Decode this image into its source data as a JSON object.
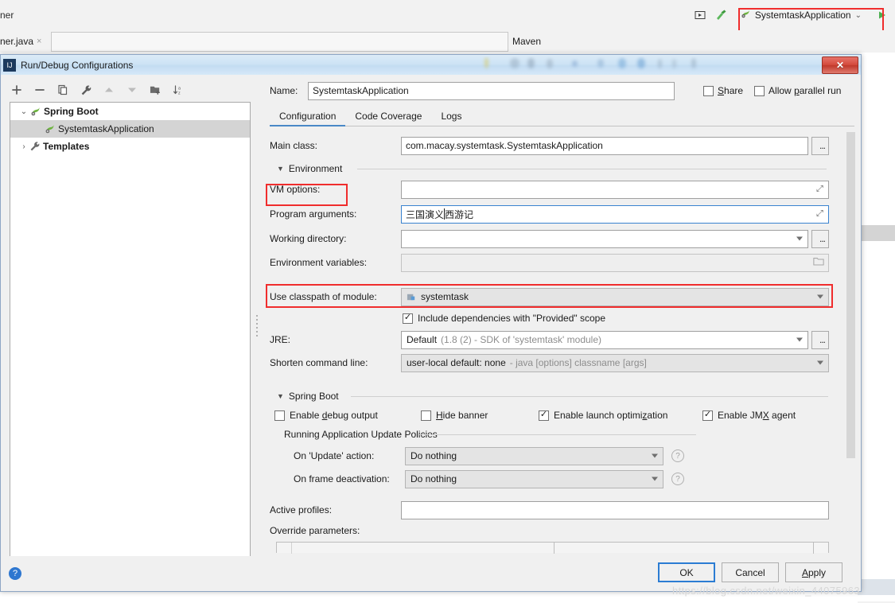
{
  "ide": {
    "topbar_label": "ner",
    "run_config_chip": "SystemtaskApplication",
    "editor_tab": "ner.java",
    "editor_tab_close": "×",
    "maven_label": "Maven"
  },
  "dialog": {
    "title": "Run/Debug Configurations",
    "close_label": "✕",
    "toolbar": {
      "add": "+",
      "remove": "−",
      "copy": "copy",
      "edit_templates": "wrench",
      "move_up": "▲",
      "move_down": "▼",
      "new_folder": "folder-add",
      "sort": "sort-alpha"
    },
    "tree": [
      {
        "label": "Spring Boot",
        "expanded": true,
        "twisty": "⌄",
        "bold": true,
        "selected": false
      },
      {
        "label": "SystemtaskApplication",
        "expanded": false,
        "twisty": "",
        "bold": false,
        "selected": true
      },
      {
        "label": "Templates",
        "expanded": false,
        "twisty": "›",
        "bold": true,
        "selected": false
      }
    ],
    "name_label": "Name:",
    "name_value": "SystemtaskApplication",
    "share_label": "Share",
    "share_mnemonic": "S",
    "share_checked": false,
    "allow_parallel_label": "Allow parallel run",
    "allow_parallel_checked": false,
    "tabs": [
      {
        "label": "Configuration",
        "active": true
      },
      {
        "label": "Code Coverage",
        "active": false
      },
      {
        "label": "Logs",
        "active": false
      }
    ],
    "fields": {
      "main_class_label": "Main class:",
      "main_class_value": "com.macay.systemtask.SystemtaskApplication",
      "environment_section": "Environment",
      "vm_options_label": "VM options:",
      "vm_options_value": "",
      "program_arguments_label": "Program arguments:",
      "program_arguments_value": "三国演义 西游记",
      "program_arguments_pre_caret": "三国演义 ",
      "program_arguments_post_caret": "西游记",
      "working_directory_label": "Working directory:",
      "working_directory_value": "",
      "environment_variables_label": "Environment variables:",
      "environment_variables_value": "",
      "classpath_label": "Use classpath of module:",
      "classpath_value": "systemtask",
      "include_provided_label": "Include dependencies with \"Provided\" scope",
      "include_provided_checked": true,
      "jre_label": "JRE:",
      "jre_value_main": "Default",
      "jre_value_detail": "(1.8 (2) - SDK of 'systemtask' module)",
      "shorten_label": "Shorten command line:",
      "shorten_value_main": "user-local default: none",
      "shorten_value_detail": "- java [options] classname [args]",
      "spring_boot_section": "Spring Boot",
      "enable_debug_label": "Enable debug output",
      "enable_debug_mnemonic": "d",
      "enable_debug_checked": false,
      "hide_banner_label": "Hide banner",
      "hide_banner_mnemonic": "H",
      "hide_banner_checked": false,
      "enable_launch_opt_label": "Enable launch optimization",
      "enable_launch_opt_checked": true,
      "enable_jmx_label": "Enable JMX agent",
      "enable_jmx_checked": true,
      "update_policies_section": "Running Application Update Policies",
      "on_update_label": "On 'Update' action:",
      "on_update_value": "Do nothing",
      "on_frame_label": "On frame deactivation:",
      "on_frame_value": "Do nothing",
      "active_profiles_label": "Active profiles:",
      "active_profiles_value": "",
      "override_parameters_label": "Override parameters:"
    },
    "footer": {
      "help": "?",
      "ok": "OK",
      "cancel": "Cancel",
      "apply": "Apply",
      "apply_mnemonic": "A"
    }
  },
  "watermark": "https://blog.csdn.net/weixin_44075963",
  "colors": {
    "accent_red": "#f02d2d",
    "accent_blue": "#2b7cd3",
    "spring_green": "#6db33f"
  }
}
